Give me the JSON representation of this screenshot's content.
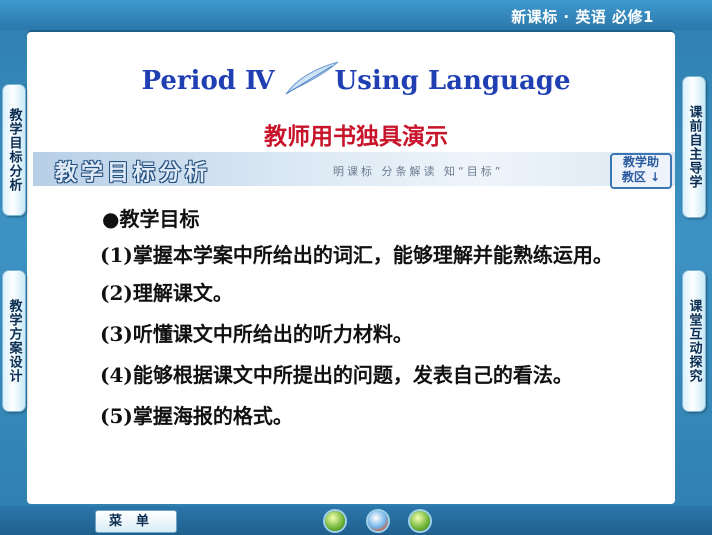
{
  "header": {
    "course_title": "新课标 · 英语  必修1"
  },
  "left_tabs": [
    {
      "label": "教学目标分析"
    },
    {
      "label": "教学方案设计"
    }
  ],
  "right_tabs": [
    {
      "label": "课前自主导学"
    },
    {
      "label": "课堂互动探究"
    }
  ],
  "title": {
    "left": "Period  Ⅳ",
    "right": "Using Language"
  },
  "subtitle": "教师用书独具演示",
  "section": {
    "title": "教学目标分析",
    "subtitle": "明课标  分条解读  知“目标”",
    "help_line1": "教学助",
    "help_line2": "教区 ↓"
  },
  "content": {
    "heading": "●教学目标",
    "items": [
      "(1)掌握本学案中所给出的词汇，能够理解并能熟练运用。",
      "(2)理解课文。",
      "(3)听懂课文中所给出的听力材料。",
      "(4)能够根据课文中所提出的问题，发表自己的看法。",
      "(5)掌握海报的格式。"
    ]
  },
  "footer": {
    "menu_label": "菜单"
  },
  "icons": [
    "back-icon",
    "home-icon",
    "forward-icon"
  ],
  "colors": {
    "title_blue": "#1f3fb3",
    "subtitle_red": "#c8142b",
    "frame_blue": "#2f7fb0"
  }
}
